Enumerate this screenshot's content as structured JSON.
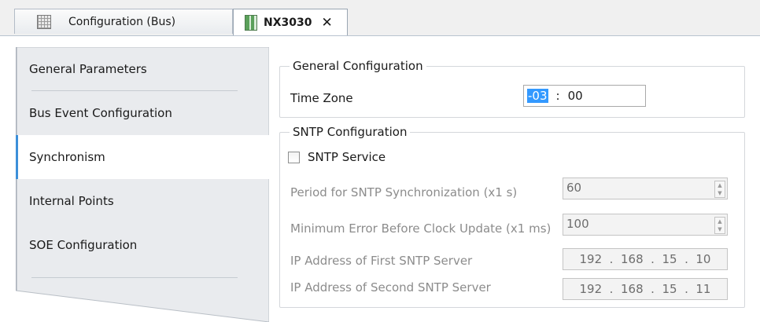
{
  "tabs": [
    {
      "label": "Configuration (Bus)",
      "icon": "bus-config-icon"
    },
    {
      "label": "NX3030",
      "icon": "device-icon",
      "close": "✕"
    }
  ],
  "sidebar": {
    "items": [
      {
        "label": "General Parameters"
      },
      {
        "label": "Bus Event Configuration"
      },
      {
        "label": "Synchronism",
        "active": true
      },
      {
        "label": "Internal Points"
      },
      {
        "label": "SOE Configuration"
      }
    ]
  },
  "general_config": {
    "title": "General Configuration",
    "time_zone_label": "Time Zone",
    "time_zone_hours": "-03",
    "time_zone_sep": ":",
    "time_zone_minutes": "00"
  },
  "sntp_config": {
    "title": "SNTP Configuration",
    "service_label": "SNTP Service",
    "service_checked": false,
    "period_label": "Period for SNTP Synchronization (x1 s)",
    "period_value": "60",
    "min_error_label": "Minimum Error Before Clock Update (x1 ms)",
    "min_error_value": "100",
    "ip1_label": "IP Address of First SNTP Server",
    "ip1_value": "192  .  168  .  15  .  10",
    "ip2_label": "IP Address of Second SNTP Server",
    "ip2_value": "192  .  168  .  15  .  11"
  },
  "colors": {
    "active_accent": "#3c8fd9",
    "selection": "#3399ff"
  }
}
